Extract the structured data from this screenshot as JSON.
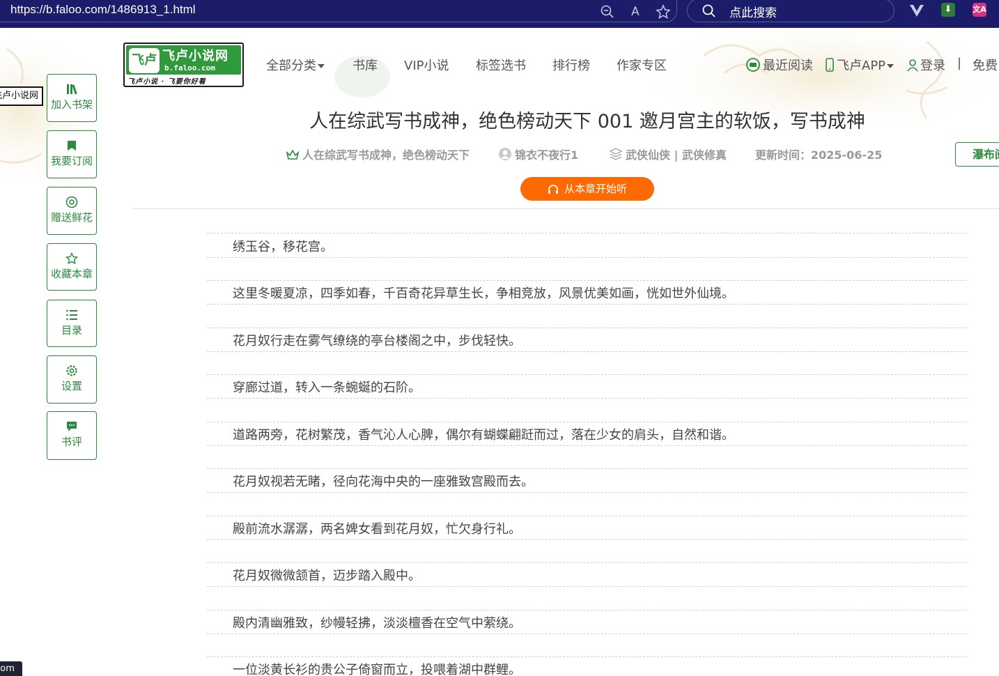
{
  "browser": {
    "url": "https://b.faloo.com/1486913_1.html",
    "search_placeholder": "点此搜索",
    "read_aloud_glyph": "A",
    "translate_glyph": "文A"
  },
  "site": {
    "logo_name": "飞卢小说网",
    "logo_emblem": "飞卢",
    "logo_url": "b.faloo.com",
    "logo_slogan": "飞卢小说 · 飞要你好看",
    "nav": [
      "全部分类",
      "书库",
      "VIP小说",
      "标签选书",
      "排行榜",
      "作家专区"
    ],
    "right_nav": {
      "recent": "最近阅读",
      "app": "飞卢APP",
      "login": "登录",
      "separator": "|",
      "free": "免费"
    }
  },
  "tooltip": "飞卢小说网",
  "status_text": ".com",
  "tools": [
    {
      "label": "加入书架",
      "icon": "bookshelf-icon"
    },
    {
      "label": "我要订阅",
      "icon": "bookmark-icon"
    },
    {
      "label": "赠送鲜花",
      "icon": "flower-icon"
    },
    {
      "label": "收藏本章",
      "icon": "star-icon"
    },
    {
      "label": "目录",
      "icon": "list-icon"
    },
    {
      "label": "设置",
      "icon": "settings-icon"
    },
    {
      "label": "书评",
      "icon": "comment-icon"
    }
  ],
  "chapter": {
    "title": "人在综武写书成神，绝色榜动天下 001 邀月宫主的软饭，写书成神",
    "book": "人在综武写书成神，绝色榜动天下",
    "author": "锦衣不夜行1",
    "category": "武侠仙侠 | 武侠修真",
    "updated": "更新时间：2025-06-25",
    "waterfall": "瀑布阅读",
    "listen": "从本章开始听"
  },
  "paragraphs": [
    "绣玉谷，移花宫。",
    "这里冬暖夏凉，四季如春，千百奇花异草生长，争相竞放，风景优美如画，恍如世外仙境。",
    "花月奴行走在雾气缭绕的亭台楼阁之中，步伐轻快。",
    "穿廊过道，转入一条蜿蜒的石阶。",
    "道路两旁，花树繁茂，香气沁人心脾，偶尔有蝴蝶翩跹而过，落在少女的肩头，自然和谐。",
    "花月奴视若无睹，径向花海中央的一座雅致宫殿而去。",
    "殿前流水潺潺，两名婢女看到花月奴，忙欠身行礼。",
    "花月奴微微颔首，迈步踏入殿中。",
    "殿内清幽雅致，纱幔轻拂，淡淡檀香在空气中萦绕。",
    "一位淡黄长衫的贵公子倚窗而立，投喂着湖中群鲤。"
  ],
  "colors": {
    "browser_bar": "#1b1d6b",
    "brand_green": "#2b8a3e",
    "listen_orange": "#ff6a00"
  }
}
